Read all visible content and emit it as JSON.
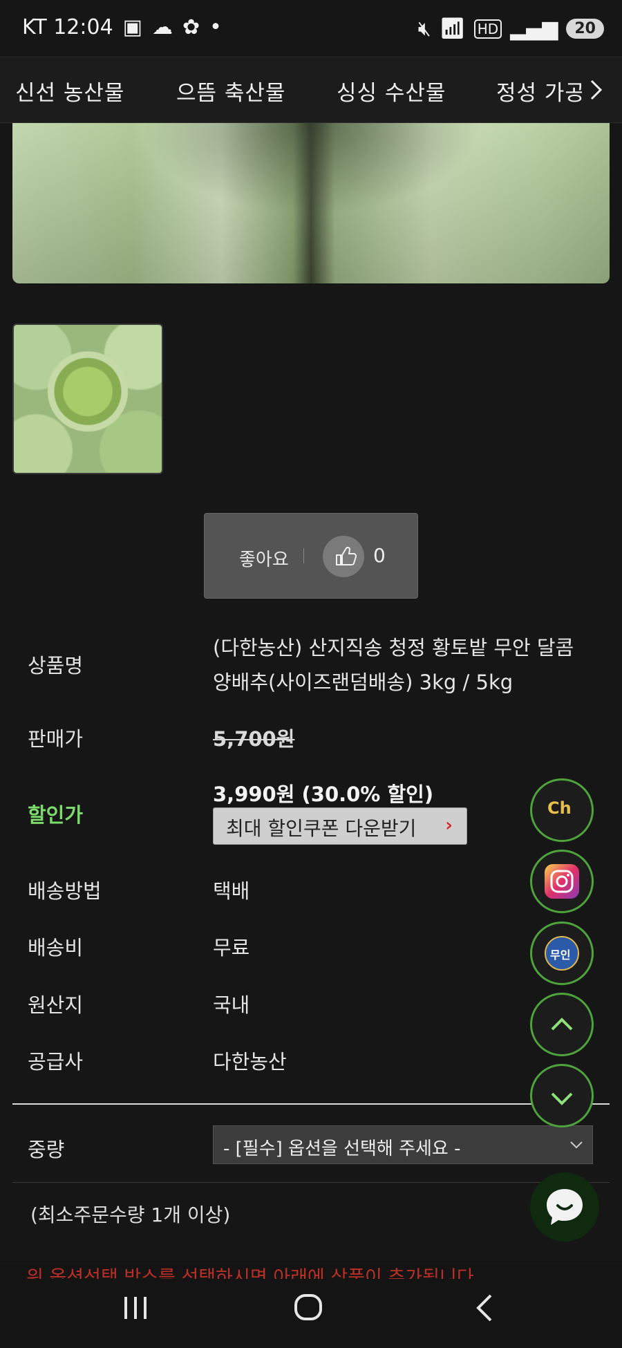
{
  "status_bar": {
    "carrier_time": "KT 12:04",
    "battery": "20",
    "network": "HD"
  },
  "category_nav": {
    "items": [
      "신선 농산물",
      "으뜸 축산물",
      "싱싱 수산물",
      "정성 가공"
    ]
  },
  "like": {
    "label": "좋아요",
    "count": "0"
  },
  "product": {
    "name_label": "상품명",
    "name_line1": "(다한농산) 산지직송 청정 황토밭 무안 달콤",
    "name_line2": "양배추(사이즈랜덤배송) 3kg / 5kg",
    "price_label": "판매가",
    "price": "5,700원",
    "sale_label": "할인가",
    "sale_price": "3,990원 (30.0% 할인)",
    "coupon_button": "최대 할인쿠폰 다운받기",
    "delivery_method_label": "배송방법",
    "delivery_method": "택배",
    "shipping_fee_label": "배송비",
    "shipping_fee": "무료",
    "origin_label": "원산지",
    "origin": "국내",
    "supplier_label": "공급사",
    "supplier": "다한농산"
  },
  "options": {
    "weight_label": "중량",
    "weight_select": "- [필수] 옵션을 선택해 주세요 -",
    "min_order": "(최소주문수량 1개 이상)",
    "notice": "위 옵션선택 박스를 선택하시면 아래에 상품이 추가됩니다."
  },
  "floating": {
    "channel_label": "Ch",
    "kakao_label": "무인"
  },
  "colors": {
    "accent_green": "#7ddb6e",
    "fab_border": "#4ea33d",
    "background": "#161616"
  }
}
